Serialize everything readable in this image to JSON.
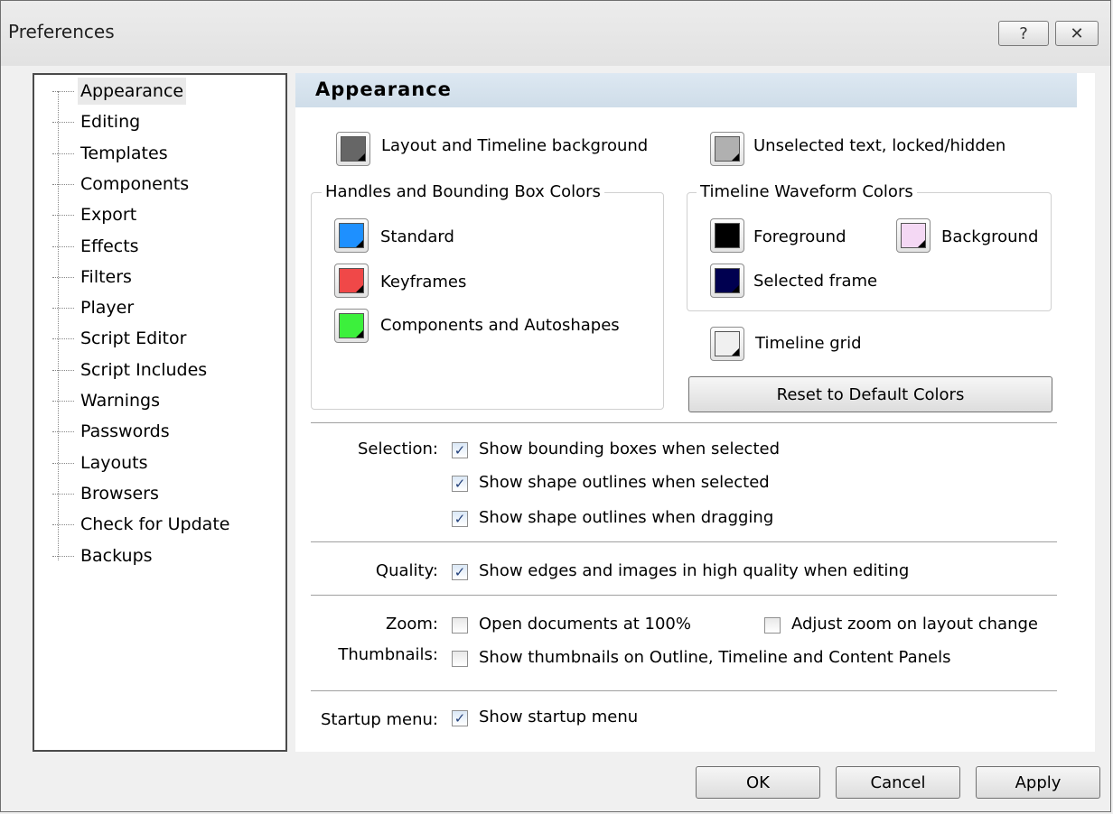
{
  "window": {
    "title": "Preferences",
    "help_glyph": "?",
    "close_glyph": "✕"
  },
  "tree": {
    "items": [
      {
        "label": "Appearance",
        "selected": true
      },
      {
        "label": "Editing"
      },
      {
        "label": "Templates"
      },
      {
        "label": "Components"
      },
      {
        "label": "Export"
      },
      {
        "label": "Effects"
      },
      {
        "label": "Filters"
      },
      {
        "label": "Player"
      },
      {
        "label": "Script Editor"
      },
      {
        "label": "Script Includes"
      },
      {
        "label": "Warnings"
      },
      {
        "label": "Passwords"
      },
      {
        "label": "Layouts"
      },
      {
        "label": "Browsers"
      },
      {
        "label": "Check for Update"
      },
      {
        "label": "Backups"
      }
    ]
  },
  "section": {
    "title": "Appearance"
  },
  "colors": {
    "layout_bg": {
      "label": "Layout and Timeline background",
      "color": "#666666"
    },
    "unselected_text": {
      "label": "Unselected text, locked/hidden",
      "color": "#b0b0b0"
    },
    "handles_group": {
      "title": "Handles and Bounding Box Colors",
      "standard": {
        "label": "Standard",
        "color": "#1e90ff"
      },
      "keyframes": {
        "label": "Keyframes",
        "color": "#f04848"
      },
      "components": {
        "label": "Components and Autoshapes",
        "color": "#3cf03c"
      }
    },
    "waveform_group": {
      "title": "Timeline Waveform Colors",
      "foreground": {
        "label": "Foreground",
        "color": "#000000"
      },
      "background": {
        "label": "Background",
        "color": "#f4d8f4"
      },
      "selected_frame": {
        "label": "Selected frame",
        "color": "#000050"
      }
    },
    "timeline_grid": {
      "label": "Timeline grid",
      "color": "#f0f0f0"
    },
    "reset_button": "Reset to Default Colors"
  },
  "options": {
    "selection": {
      "label": "Selection:",
      "items": [
        {
          "label": "Show bounding boxes when selected",
          "checked": true
        },
        {
          "label": "Show shape outlines when selected",
          "checked": true
        },
        {
          "label": "Show shape outlines when dragging",
          "checked": true
        }
      ]
    },
    "quality": {
      "label": "Quality:",
      "item": {
        "label": "Show edges and images in high quality when editing",
        "checked": true
      }
    },
    "zoom": {
      "label": "Zoom:",
      "open_100": {
        "label": "Open documents at 100%",
        "checked": false
      },
      "adjust_zoom": {
        "label": "Adjust zoom on layout change",
        "checked": false
      }
    },
    "thumbnails": {
      "label": "Thumbnails:",
      "item": {
        "label": "Show thumbnails on Outline, Timeline and Content Panels",
        "checked": false
      }
    },
    "startup": {
      "label": "Startup menu:",
      "item": {
        "label": "Show startup menu",
        "checked": true
      }
    }
  },
  "buttons": {
    "ok": "OK",
    "cancel": "Cancel",
    "apply": "Apply"
  }
}
